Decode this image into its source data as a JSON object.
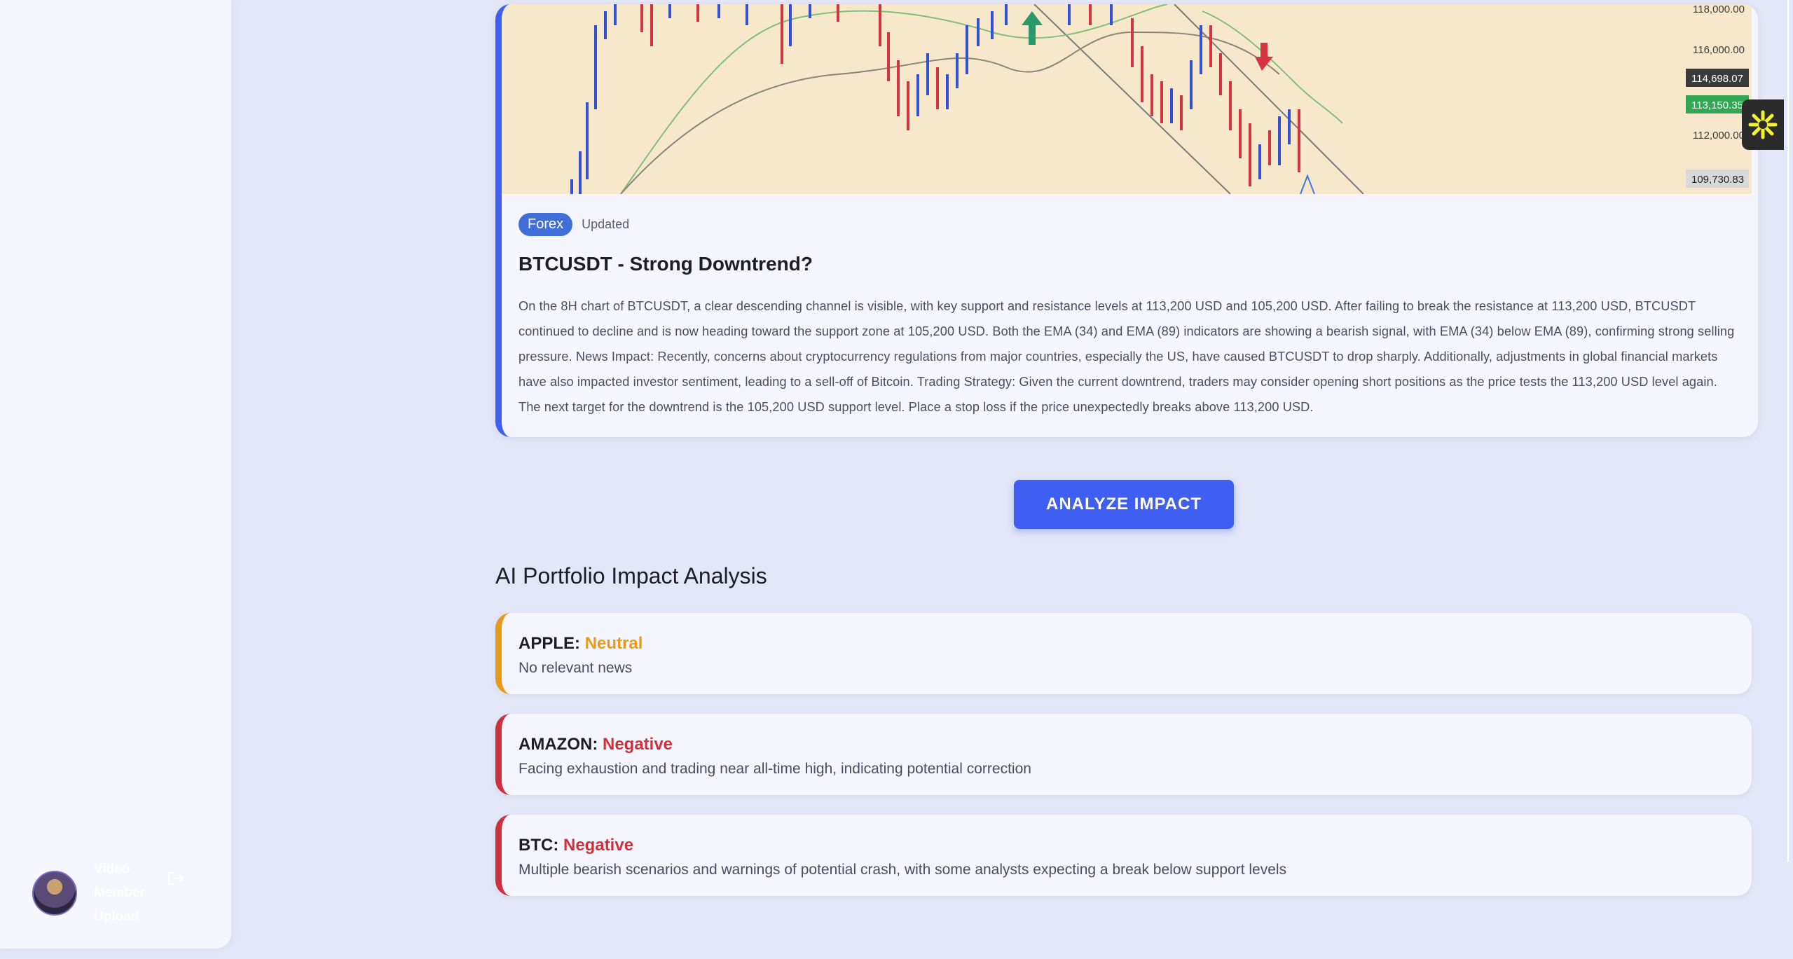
{
  "sidebar": {
    "user": {
      "name": "Video",
      "line2": "Member",
      "line3": "Upload"
    }
  },
  "news": {
    "tag": "Forex",
    "status": "Updated",
    "title": "BTCUSDT - Strong Downtrend?",
    "body": "On the 8H chart of BTCUSDT, a clear descending channel is visible, with key support and resistance levels at 113,200 USD and 105,200 USD. After failing to break the resistance at 113,200 USD, BTCUSDT continued to decline and is now heading toward the support zone at 105,200 USD. Both the EMA (34) and EMA (89) indicators are showing a bearish signal, with EMA (34) below EMA (89), confirming strong selling pressure. News Impact: Recently, concerns about cryptocurrency regulations from major countries, especially the US, have caused BTCUSDT to drop sharply. Additionally, adjustments in global financial markets have also impacted investor sentiment, leading to a sell-off of Bitcoin. Trading Strategy: Given the current downtrend, traders may consider opening short positions as the price tests the 113,200 USD level again. The next target for the downtrend is the 105,200 USD support level. Place a stop loss if the price unexpectedly breaks above 113,200 USD.",
    "chart_labels": {
      "p1": "118,000.00",
      "p2": "116,000.00",
      "p3": "114,698.07",
      "p4": "113,150.35",
      "p5": "112,000.00",
      "p6": "109,730.83"
    }
  },
  "actions": {
    "analyze_label": "ANALYZE IMPACT"
  },
  "analysis": {
    "title": "AI Portfolio Impact Analysis",
    "items": [
      {
        "asset": "APPLE:",
        "sentiment": "Neutral",
        "note": "No relevant news",
        "color": "#e69a18"
      },
      {
        "asset": "AMAZON:",
        "sentiment": "Negative",
        "note": "Facing exhaustion and trading near all-time high, indicating potential correction",
        "color": "#d0303a"
      },
      {
        "asset": "BTC:",
        "sentiment": "Negative",
        "note": "Multiple bearish scenarios and warnings of potential crash, with some analysts expecting a break below support levels",
        "color": "#d0303a"
      }
    ]
  },
  "colors": {
    "accent": "#3f5ef2",
    "neutral": "#e69a18",
    "negative": "#d0303a",
    "chart_bg": "#f7e8cc"
  },
  "icons": {
    "logout": "logout-icon",
    "ai_widget": "sparkle-icon"
  }
}
